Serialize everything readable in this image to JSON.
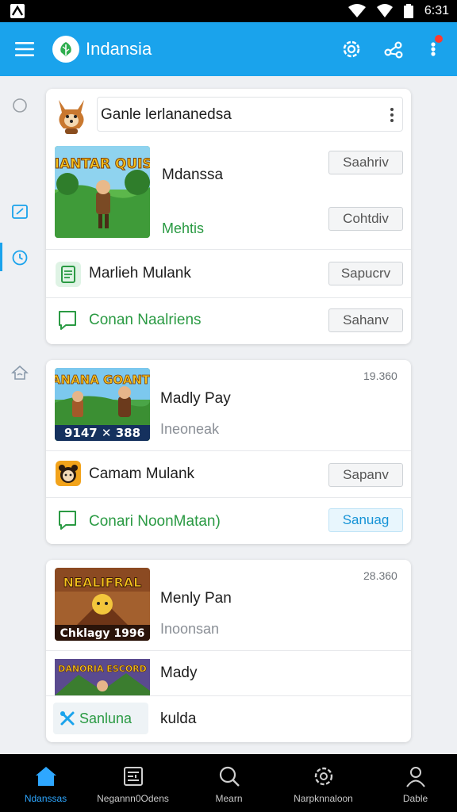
{
  "status_bar": {
    "time": "6:31"
  },
  "app_bar": {
    "title": "Indansia"
  },
  "cards": [
    {
      "search_text": "Ganle lerlananedsa",
      "game": {
        "title": "Mdanssa",
        "subtitle": "Mehtis",
        "thumb_text": "DIANTAR QUISE",
        "button_top": "Saahriv",
        "button_bottom": "Cohtdiv"
      },
      "rows": [
        {
          "label": "Marlieh Mulank",
          "button": "Sapucrv"
        },
        {
          "label": "Conan Naalriens",
          "button": "Sahanv"
        }
      ]
    },
    {
      "number": "19.360",
      "game": {
        "title": "Madly Pay",
        "subtitle": "Ineoneak",
        "thumb_text": "DANANA GOANTIS",
        "thumb_caption": "9147 ✕ 388"
      },
      "rows": [
        {
          "label": "Camam Mulank",
          "button": "Sapanv"
        },
        {
          "label": "Conari NoonMatan)",
          "button": "Sanuag"
        }
      ]
    },
    {
      "number": "28.360",
      "game": {
        "title": "Menly Pan",
        "subtitle": "Inoonsan",
        "thumb_text": "NEALIFRAL",
        "thumb_caption": "Chklagy 1996"
      },
      "rows": [
        {
          "label": "Mady",
          "thumb_text": "DANORIA ESCORD"
        },
        {
          "label": "kulda",
          "chip": "Sanluna"
        }
      ]
    }
  ],
  "bottom_nav": [
    {
      "label": "Ndanssas",
      "icon": "home-icon",
      "active": true
    },
    {
      "label": "Negannn0Odens",
      "icon": "news-icon",
      "active": false
    },
    {
      "label": "Mearn",
      "icon": "search-icon",
      "active": false
    },
    {
      "label": "Narpknnaloon",
      "icon": "settings-icon",
      "active": false
    },
    {
      "label": "Dable",
      "icon": "profile-icon",
      "active": false
    }
  ],
  "colors": {
    "accent": "#1aa3ec",
    "green": "#2a9a43",
    "status_bg": "#000000"
  }
}
